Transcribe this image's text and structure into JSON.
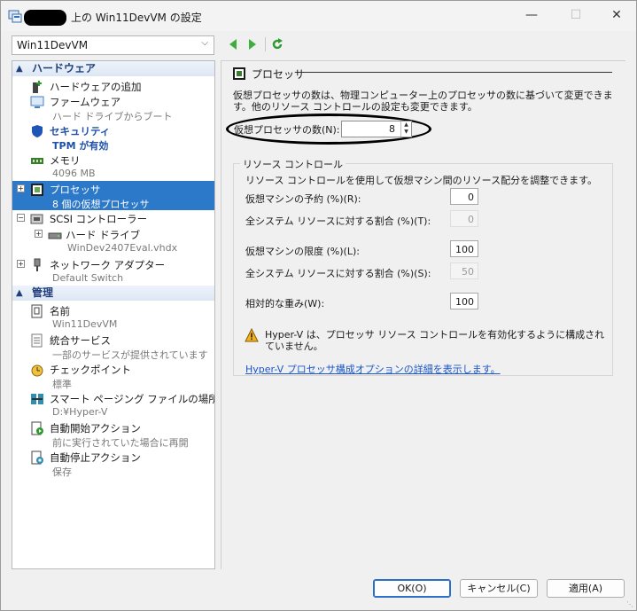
{
  "window": {
    "title": "上の Win11DevVM の設定",
    "controls": {
      "minimize": "—",
      "maximize": "☐",
      "close": "✕"
    }
  },
  "toolbar": {
    "vm_name": "Win11DevVM",
    "dropdown_icon": "chevron-down-icon",
    "back_icon": "back-arrow-icon",
    "forward_icon": "forward-arrow-icon",
    "refresh_icon": "refresh-icon"
  },
  "sidebar": {
    "hardware_header": "ハードウェア",
    "management_header": "管理",
    "hardware_items": [
      {
        "label": "ハードウェアの追加",
        "sub": ""
      },
      {
        "label": "ファームウェア",
        "sub": "ハード ドライブからブート"
      },
      {
        "label": "セキュリティ",
        "sub": "TPM が有効"
      },
      {
        "label": "メモリ",
        "sub": "4096 MB"
      },
      {
        "label": "プロセッサ",
        "sub": "8 個の仮想プロセッサ"
      },
      {
        "label": "SCSI コントローラー",
        "sub": ""
      },
      {
        "label": "ハード ドライブ",
        "sub": "WinDev2407Eval.vhdx"
      },
      {
        "label": "ネットワーク アダプター",
        "sub": "Default Switch"
      }
    ],
    "management_items": [
      {
        "label": "名前",
        "sub": "Win11DevVM"
      },
      {
        "label": "統合サービス",
        "sub": "一部のサービスが提供されています"
      },
      {
        "label": "チェックポイント",
        "sub": "標準"
      },
      {
        "label": "スマート ページング ファイルの場所",
        "sub": "D:¥Hyper-V"
      },
      {
        "label": "自動開始アクション",
        "sub": "前に実行されていた場合に再開"
      },
      {
        "label": "自動停止アクション",
        "sub": "保存"
      }
    ]
  },
  "panel": {
    "title": "プロセッサ",
    "description": "仮想プロセッサの数は、物理コンピューター上のプロセッサの数に基づいて変更できます。他のリソース コントロールの設定も変更できます。",
    "count_label": "仮想プロセッサの数(N):",
    "count_value": "8",
    "resource": {
      "legend": "リソース コントロール",
      "intro": "リソース コントロールを使用して仮想マシン間のリソース配分を調整できます。",
      "reserve_label": "仮想マシンの予約 (%)(R):",
      "reserve_value": "0",
      "reserve_total_label": "全システム リソースに対する割合 (%)(T):",
      "reserve_total_value": "0",
      "limit_label": "仮想マシンの限度 (%)(L):",
      "limit_value": "100",
      "limit_total_label": "全システム リソースに対する割合 (%)(S):",
      "limit_total_value": "50",
      "weight_label": "相対的な重み(W):",
      "weight_value": "100",
      "warning": "Hyper-V は、プロセッサ リソース コントロールを有効化するように構成されていません。",
      "link": "Hyper-V プロセッサ構成オプションの詳細を表示します。"
    }
  },
  "buttons": {
    "ok": "OK(O)",
    "cancel": "キャンセル(C)",
    "apply": "適用(A)"
  },
  "colors": {
    "selected": "#2c78c9",
    "header": "#1f3e7a",
    "link": "#1a56c7"
  }
}
